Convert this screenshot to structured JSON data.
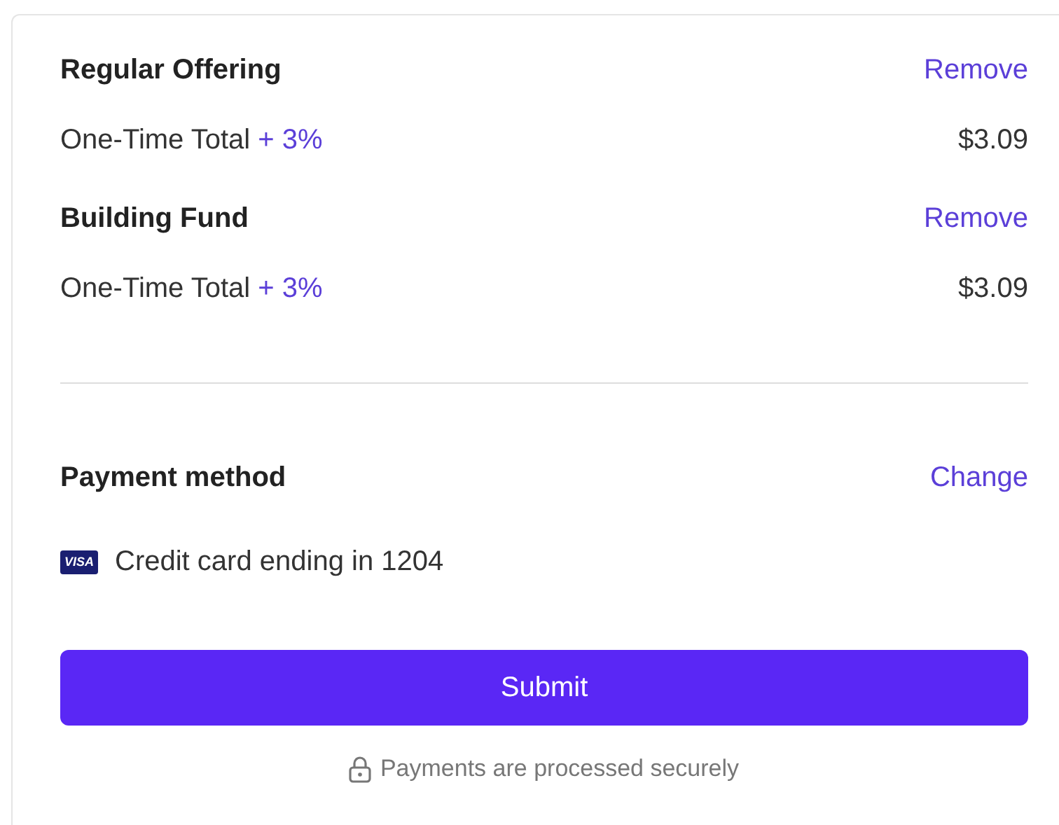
{
  "items": [
    {
      "name": "Regular Offering",
      "action": "Remove",
      "total_label": "One-Time Total",
      "fee": "+ 3%",
      "amount": "$3.09"
    },
    {
      "name": "Building Fund",
      "action": "Remove",
      "total_label": "One-Time Total",
      "fee": "+ 3%",
      "amount": "$3.09"
    }
  ],
  "payment": {
    "title": "Payment method",
    "action": "Change",
    "card_brand": "VISA",
    "card_text": "Credit card ending in 1204"
  },
  "submit": "Submit",
  "secure_note": "Payments are processed securely"
}
